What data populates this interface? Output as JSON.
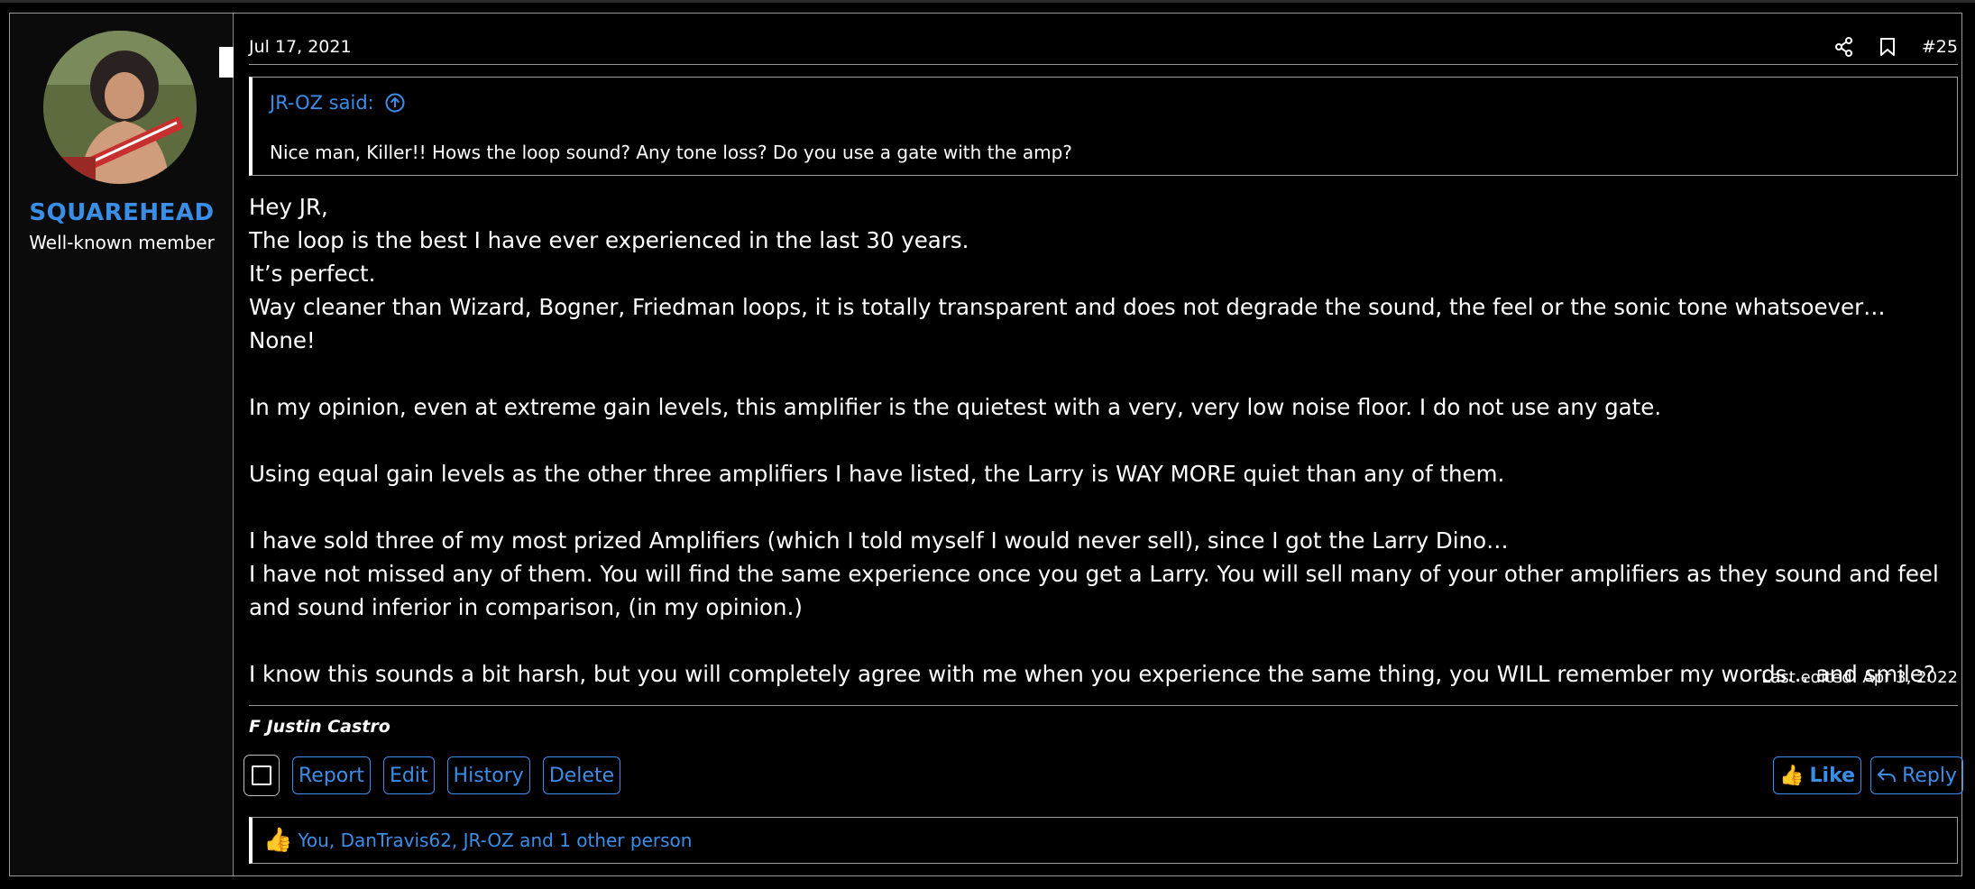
{
  "post": {
    "date": "Jul 17, 2021",
    "number": "#25",
    "user": {
      "name": "SQUAREHEAD",
      "title": "Well-known member"
    },
    "quote": {
      "author": "JR-OZ said:",
      "text": "Nice man, Killer!! Hows the loop sound? Any tone loss? Do you use a gate with the amp?"
    },
    "message": {
      "p1": "Hey JR,",
      "p2": "The loop is the best I have ever experienced in the last 30 years.",
      "p3": "It’s perfect.",
      "p4": "Way cleaner than Wizard, Bogner, Friedman loops, it is totally transparent and does not degrade the sound, the feel or the sonic tone whatsoever… None!",
      "p5": "In my opinion, even at extreme gain levels, this amplifier is the quietest with a very, very low noise floor. I do not use any gate.",
      "p6": "Using equal gain levels as the other three amplifiers I have listed, the Larry is WAY MORE quiet than any of them.",
      "p7": "I have sold three of my most prized Amplifiers (which I told myself I would never sell), since I got the Larry Dino…",
      "p8": "I have not missed any of them. You will find the same experience once you get a Larry. You will sell many of your other amplifiers as they sound and feel and sound inferior in comparison, (in my opinion.)",
      "p9": "I know this sounds a bit harsh, but you will completely agree with me when you experience the same thing, you WILL remember my words… and smile?"
    },
    "last_edited": "Last edited: Apr 3, 2022",
    "signature": "F Justin Castro",
    "actions": {
      "report": "Report",
      "edit": "Edit",
      "history": "History",
      "delete": "Delete",
      "like": "Like",
      "reply": "Reply"
    },
    "reactions": "You, DanTravis62, JR-OZ and 1 other person"
  },
  "colors": {
    "background": "#000000",
    "accent": "#3b8ee8",
    "border": "#9a9a9a"
  },
  "icons": [
    "share-icon",
    "bookmark-icon",
    "arrow-up-circle-icon",
    "thumbs-up-icon",
    "reply-icon",
    "checkbox-icon"
  ]
}
